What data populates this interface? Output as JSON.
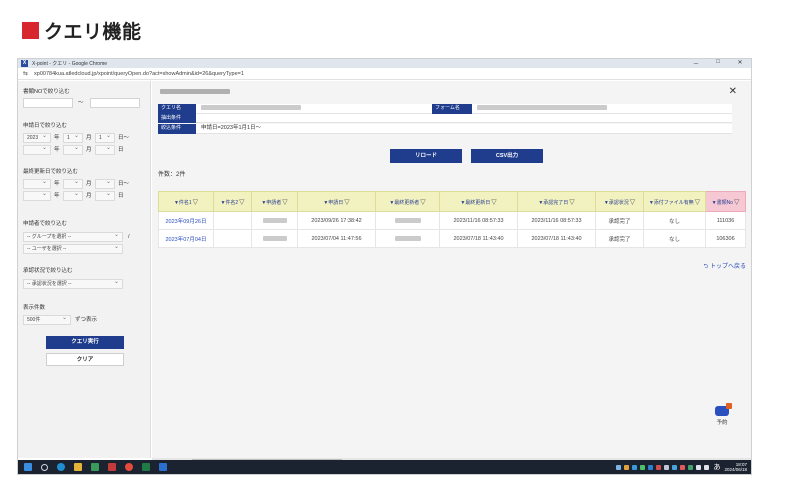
{
  "heading": "クエリ機能",
  "window": {
    "title": "X-point - クエリ - Google Chrome",
    "app_icon": "X",
    "url": "xp00784kua.atledcloud.jp/xpoint/queryOpen.do?act=showAdmin&id=26&queryType=1",
    "controls": {
      "minimize": "－",
      "maximize": "□",
      "close": "✕"
    }
  },
  "sidebar": {
    "doc_no_label": "書類NOで絞り込む",
    "doc_no_sep": "～",
    "apply_date_label": "申請日で絞り込む",
    "apply_date_row1": {
      "year": "2023",
      "y_unit": "年",
      "month": "1",
      "m_unit": "月",
      "day": "1",
      "d_unit": "日～"
    },
    "apply_date_row2": {
      "y_unit": "年",
      "m_unit": "月",
      "d_unit": "日"
    },
    "updated_label": "最終更新日で絞り込む",
    "updated_row1": {
      "y_unit": "年",
      "m_unit": "月",
      "d_unit": "日～"
    },
    "updated_row2": {
      "y_unit": "年",
      "m_unit": "月",
      "d_unit": "日"
    },
    "applicant_label": "申請者で絞り込む",
    "group_select": "-- グループを選択 --",
    "group_sep": "/",
    "user_select": "-- ユーザを選択 --",
    "status_label": "承認状況で絞り込む",
    "status_select": "-- 承認状況を選択 --",
    "display_count_label": "表示件数",
    "display_count_select": "500件",
    "display_count_suffix": "ずつ表示",
    "run_button": "クエリ実行",
    "clear_button": "クリア"
  },
  "main": {
    "close": "✕",
    "form_labels": {
      "query_name": "クエリ名",
      "extract": "抽出条件",
      "narrow": "絞込条件",
      "form_name": "フォーム名"
    },
    "narrow_value": "申請日=2023年1月1日～",
    "reload_button": "リロード",
    "csv_button": "CSV出力",
    "count_text": "件数：2件",
    "table": {
      "columns": [
        "▼件名1",
        "▼件名2",
        "▼申請者",
        "▼申請日",
        "▼最終更新者",
        "▼最終更新日",
        "▼承認完了日",
        "▼承認状況",
        "▼添付ファイル有無",
        "▼書類No"
      ],
      "rows": [
        {
          "title1": "2023年09月26日",
          "title2": "",
          "applicant": "",
          "apply_date": "2023/09/26 17:38:42",
          "updater": "",
          "updated": "2023/11/16 08:57:33",
          "approved": "2023/11/16 08:57:33",
          "status": "承認完了",
          "attach": "なし",
          "doc_no": "111036"
        },
        {
          "title1": "2023年07月04日",
          "title2": "",
          "applicant": "",
          "apply_date": "2023/07/04 11:47:56",
          "updater": "",
          "updated": "2023/07/18 11:43:40",
          "approved": "2023/07/18 11:43:40",
          "status": "承認完了",
          "attach": "なし",
          "doc_no": "106306"
        }
      ]
    },
    "top_link": "トップへ戻る",
    "help_label": "予約"
  },
  "taskbar": {
    "ime": "あ",
    "clock_time": "18:07",
    "clock_date": "2024/06/18"
  },
  "colors": {
    "accent_navy": "#1f3d8c",
    "heading_square": "#d7262d",
    "header_yellow": "#f2f2c0",
    "header_pink": "#f6c8d4",
    "link_blue": "#2a4fbf"
  }
}
